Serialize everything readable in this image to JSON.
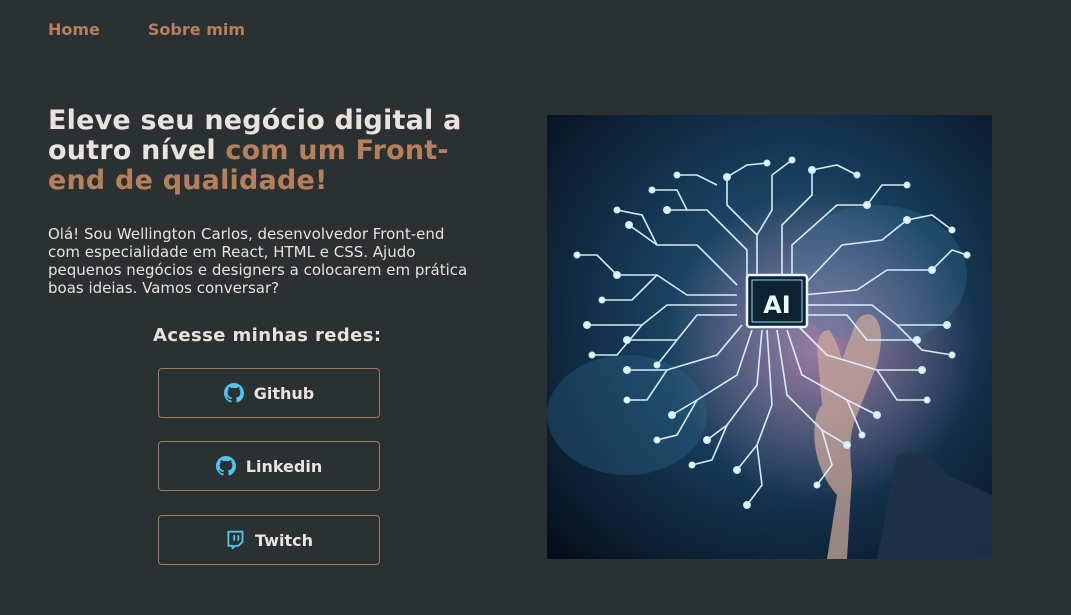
{
  "nav": {
    "home": "Home",
    "about": "Sobre mim"
  },
  "hero": {
    "title_part1": "Eleve seu negócio digital a outro nível",
    "title_part2": "com um Front-end de qualidade!",
    "intro": "Olá! Sou Wellington Carlos, desenvolvedor Front-end com especialidade em React, HTML e CSS. Ajudo pequenos negócios e designers a colocarem em prática boas ideias. Vamos conversar?"
  },
  "social": {
    "title": "Acesse minhas redes:",
    "links": [
      {
        "label": "Github",
        "icon": "github-icon"
      },
      {
        "label": "Linkedin",
        "icon": "github-icon"
      },
      {
        "label": "Twitch",
        "icon": "twitch-icon"
      }
    ]
  },
  "image": {
    "chip_label": "AI"
  },
  "colors": {
    "background": "#2b3033",
    "accent": "#b6805c",
    "text": "#eae3dc",
    "icon": "#4ec4ee"
  }
}
